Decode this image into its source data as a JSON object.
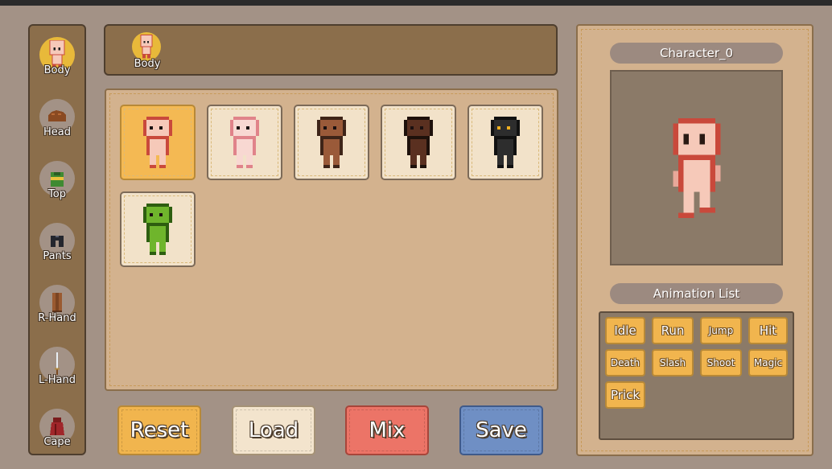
{
  "colors": {
    "background": "#a39286",
    "panel_dark": "#8b6e4b",
    "panel_light": "#d3b28e",
    "accent_gold": "#f1b54e",
    "mix_red": "#ec7467",
    "save_blue": "#6f8fc4"
  },
  "sidebar": {
    "items": [
      {
        "label": "Body",
        "icon": "body-icon",
        "active": true
      },
      {
        "label": "Head",
        "icon": "hair-icon"
      },
      {
        "label": "Top",
        "icon": "shirt-icon"
      },
      {
        "label": "Pants",
        "icon": "pants-icon"
      },
      {
        "label": "R-Hand",
        "icon": "shield-icon"
      },
      {
        "label": "L-Hand",
        "icon": "sword-icon"
      },
      {
        "label": "Cape",
        "icon": "cape-icon"
      }
    ]
  },
  "selected_bar": {
    "label": "Body",
    "icon": "body-icon"
  },
  "body_options": [
    {
      "name": "light-skin",
      "skin": "#f6c9b9",
      "shade": "#c9493b",
      "selected": true
    },
    {
      "name": "pale-skin",
      "skin": "#f8d8d2",
      "shade": "#e0838a"
    },
    {
      "name": "brown-skin",
      "skin": "#9a5a39",
      "shade": "#3e2418"
    },
    {
      "name": "dark-skin",
      "skin": "#5a3020",
      "shade": "#1e110b"
    },
    {
      "name": "shadow-skin",
      "skin": "#2d2d2d",
      "shade": "#111111",
      "eyes": "#f0b020"
    },
    {
      "name": "green-skin",
      "skin": "#6fb52c",
      "shade": "#2e5e10"
    }
  ],
  "buttons": {
    "reset": "Reset",
    "load": "Load",
    "mix": "Mix",
    "save": "Save"
  },
  "preview": {
    "character_name": "Character_0",
    "animation_list_title": "Animation List"
  },
  "animations": [
    "Idle",
    "Run",
    "Jump",
    "Hit",
    "Death",
    "Slash",
    "Shoot",
    "Magic",
    "Prick"
  ]
}
